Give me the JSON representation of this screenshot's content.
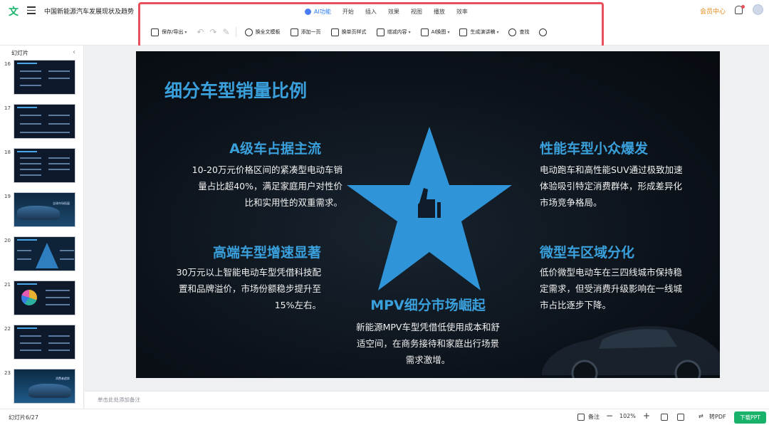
{
  "app": {
    "doc_title": "中国新能源汽车发展现状及趋势",
    "member_center": "会员中心",
    "logo_glyph": "文"
  },
  "tabs": [
    {
      "label": "AI功能",
      "active": true
    },
    {
      "label": "开始"
    },
    {
      "label": "插入"
    },
    {
      "label": "效果"
    },
    {
      "label": "视图"
    },
    {
      "label": "播放"
    },
    {
      "label": "效率"
    }
  ],
  "toolbar": {
    "save_export": "保存/导出",
    "replace_template": "换全文模板",
    "add_page": "添加一页",
    "change_page_style": "换单页样式",
    "adjust_content": "增减内容",
    "ai_image": "AI换图",
    "gen_speech": "生成演讲稿",
    "find": "查找"
  },
  "sidebar": {
    "title": "幻灯片",
    "slides": [
      {
        "num": "16"
      },
      {
        "num": "17"
      },
      {
        "num": "18"
      },
      {
        "num": "19",
        "caption": "全球市场拓展"
      },
      {
        "num": "20"
      },
      {
        "num": "21"
      },
      {
        "num": "22"
      },
      {
        "num": "23",
        "caption": "消费者趋势"
      }
    ]
  },
  "slide": {
    "title": "细分车型销量比例",
    "blocks": {
      "a_class": {
        "title": "A级车占据主流",
        "body": [
          "10-20万元价格区间的紧凑型电动车销",
          "量占比超40%，满足家庭用户对性价",
          "比和实用性的双重需求。"
        ]
      },
      "high_end": {
        "title": "高端车型增速显著",
        "body": [
          "30万元以上智能电动车型凭借科技配",
          "置和品牌溢价，市场份额稳步提升至",
          "15%左右。"
        ]
      },
      "performance": {
        "title": "性能车型小众爆发",
        "body": [
          "电动跑车和高性能SUV通过极致加速",
          "体验吸引特定消费群体，形成差异化",
          "市场竞争格局。"
        ]
      },
      "micro": {
        "title": "微型车区域分化",
        "body": [
          "低价微型电动车在三四线城市保持稳",
          "定需求，但受消费升级影响在一线城",
          "市占比逐步下降。"
        ]
      },
      "mpv": {
        "title": "MPV细分市场崛起",
        "body": [
          "新能源MPV车型凭借低使用成本和舒",
          "适空间，在商务接待和家庭出行场景",
          "需求激增。"
        ]
      }
    },
    "accent_color": "#3aa0dc"
  },
  "notes": {
    "placeholder": "单击此处添加备注"
  },
  "statusbar": {
    "slide_count": "幻灯片6/27",
    "notes_label": "备注",
    "zoom": "102%",
    "to_pdf": "转PDF",
    "download": "下载PPT"
  }
}
